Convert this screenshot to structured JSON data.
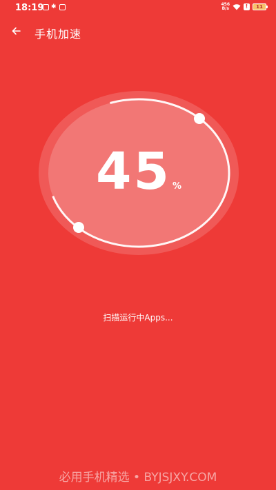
{
  "status_bar": {
    "time": "18:19",
    "net_speed_value": "456",
    "net_speed_unit": "B/s",
    "battery_level": "11",
    "icons": [
      "message-icon",
      "bluetooth-icon",
      "vibrate-icon",
      "wifi-icon",
      "alert-icon",
      "battery-icon"
    ]
  },
  "header": {
    "title": "手机加速",
    "back_icon": "back-arrow-icon"
  },
  "gauge": {
    "percent": "45",
    "unit": "%"
  },
  "scan": {
    "status_text": "扫描运行中Apps..."
  },
  "watermark": {
    "text": "必用手机精选 • BYJSJXY.COM"
  },
  "colors": {
    "background": "#ee3a37",
    "foreground": "#ffffff",
    "battery_fill": "#f7c36a"
  }
}
